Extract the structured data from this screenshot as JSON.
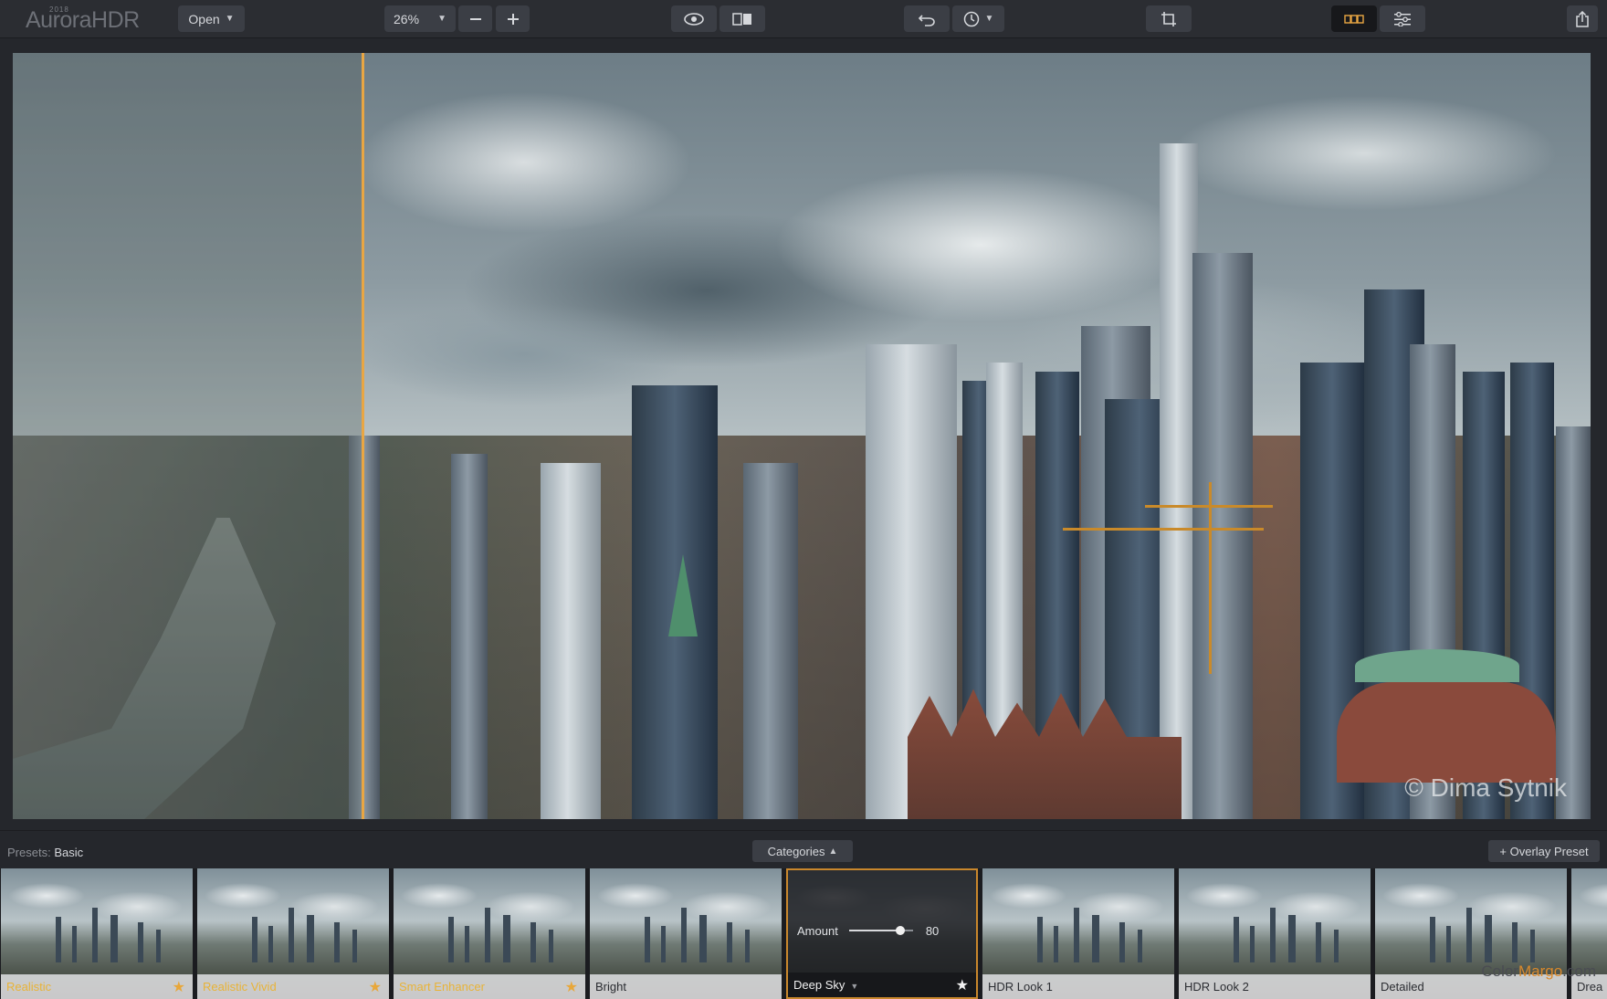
{
  "app": {
    "logo_text": "AuroraHDR",
    "logo_year": "2018"
  },
  "toolbar": {
    "open_label": "Open",
    "zoom_value": "26%",
    "zoom_out_icon": "minus-icon",
    "zoom_in_icon": "plus-icon",
    "preview_icon": "eye-icon",
    "compare_icon": "split-compare-icon",
    "undo_icon": "undo-icon",
    "history_icon": "clock-icon",
    "crop_icon": "crop-icon",
    "presets_panel_icon": "filmstrip-icon",
    "adjustments_icon": "sliders-icon",
    "share_icon": "share-icon",
    "accent_color": "#e9a643"
  },
  "canvas": {
    "watermark": "© Dima Sytnik",
    "divider_color": "#e9a643"
  },
  "presets_bar": {
    "label_prefix": "Presets:",
    "label_value": "Basic",
    "categories_label": "Categories",
    "overlay_label": "+ Overlay Preset"
  },
  "filmstrip": {
    "thumbs": [
      {
        "label": "Realistic",
        "starred": true
      },
      {
        "label": "Realistic Vivid",
        "starred": true
      },
      {
        "label": "Smart Enhancer",
        "starred": true
      },
      {
        "label": "Bright",
        "starred": false
      },
      {
        "label": "Deep Sky",
        "starred": true,
        "selected": true
      },
      {
        "label": "HDR Look 1",
        "starred": false
      },
      {
        "label": "HDR Look 2",
        "starred": false
      },
      {
        "label": "Detailed",
        "starred": false
      },
      {
        "label": "Drea",
        "starred": false
      }
    ],
    "amount_label": "Amount",
    "amount_value": "80",
    "amount_fraction": 0.8,
    "site_watermark_a": "Color",
    "site_watermark_b": "Margo",
    "site_watermark_c": ".com"
  }
}
